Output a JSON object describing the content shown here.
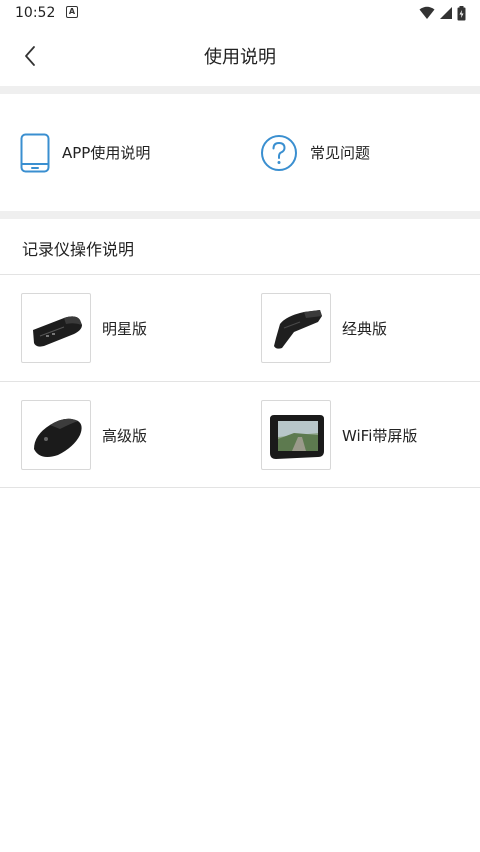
{
  "status_bar": {
    "time": "10:52",
    "notification_icon": "A"
  },
  "header": {
    "title": "使用说明"
  },
  "guides": [
    {
      "label": "APP使用说明",
      "icon": "phone-icon"
    },
    {
      "label": "常见问题",
      "icon": "question-circle-icon"
    }
  ],
  "section": {
    "title": "记录仪操作说明"
  },
  "models": [
    {
      "label": "明星版"
    },
    {
      "label": "经典版"
    },
    {
      "label": "高级版"
    },
    {
      "label": "WiFi带屏版"
    }
  ],
  "colors": {
    "accent": "#3a8fd0",
    "band": "#efefef",
    "divider": "#e3e3e3"
  }
}
